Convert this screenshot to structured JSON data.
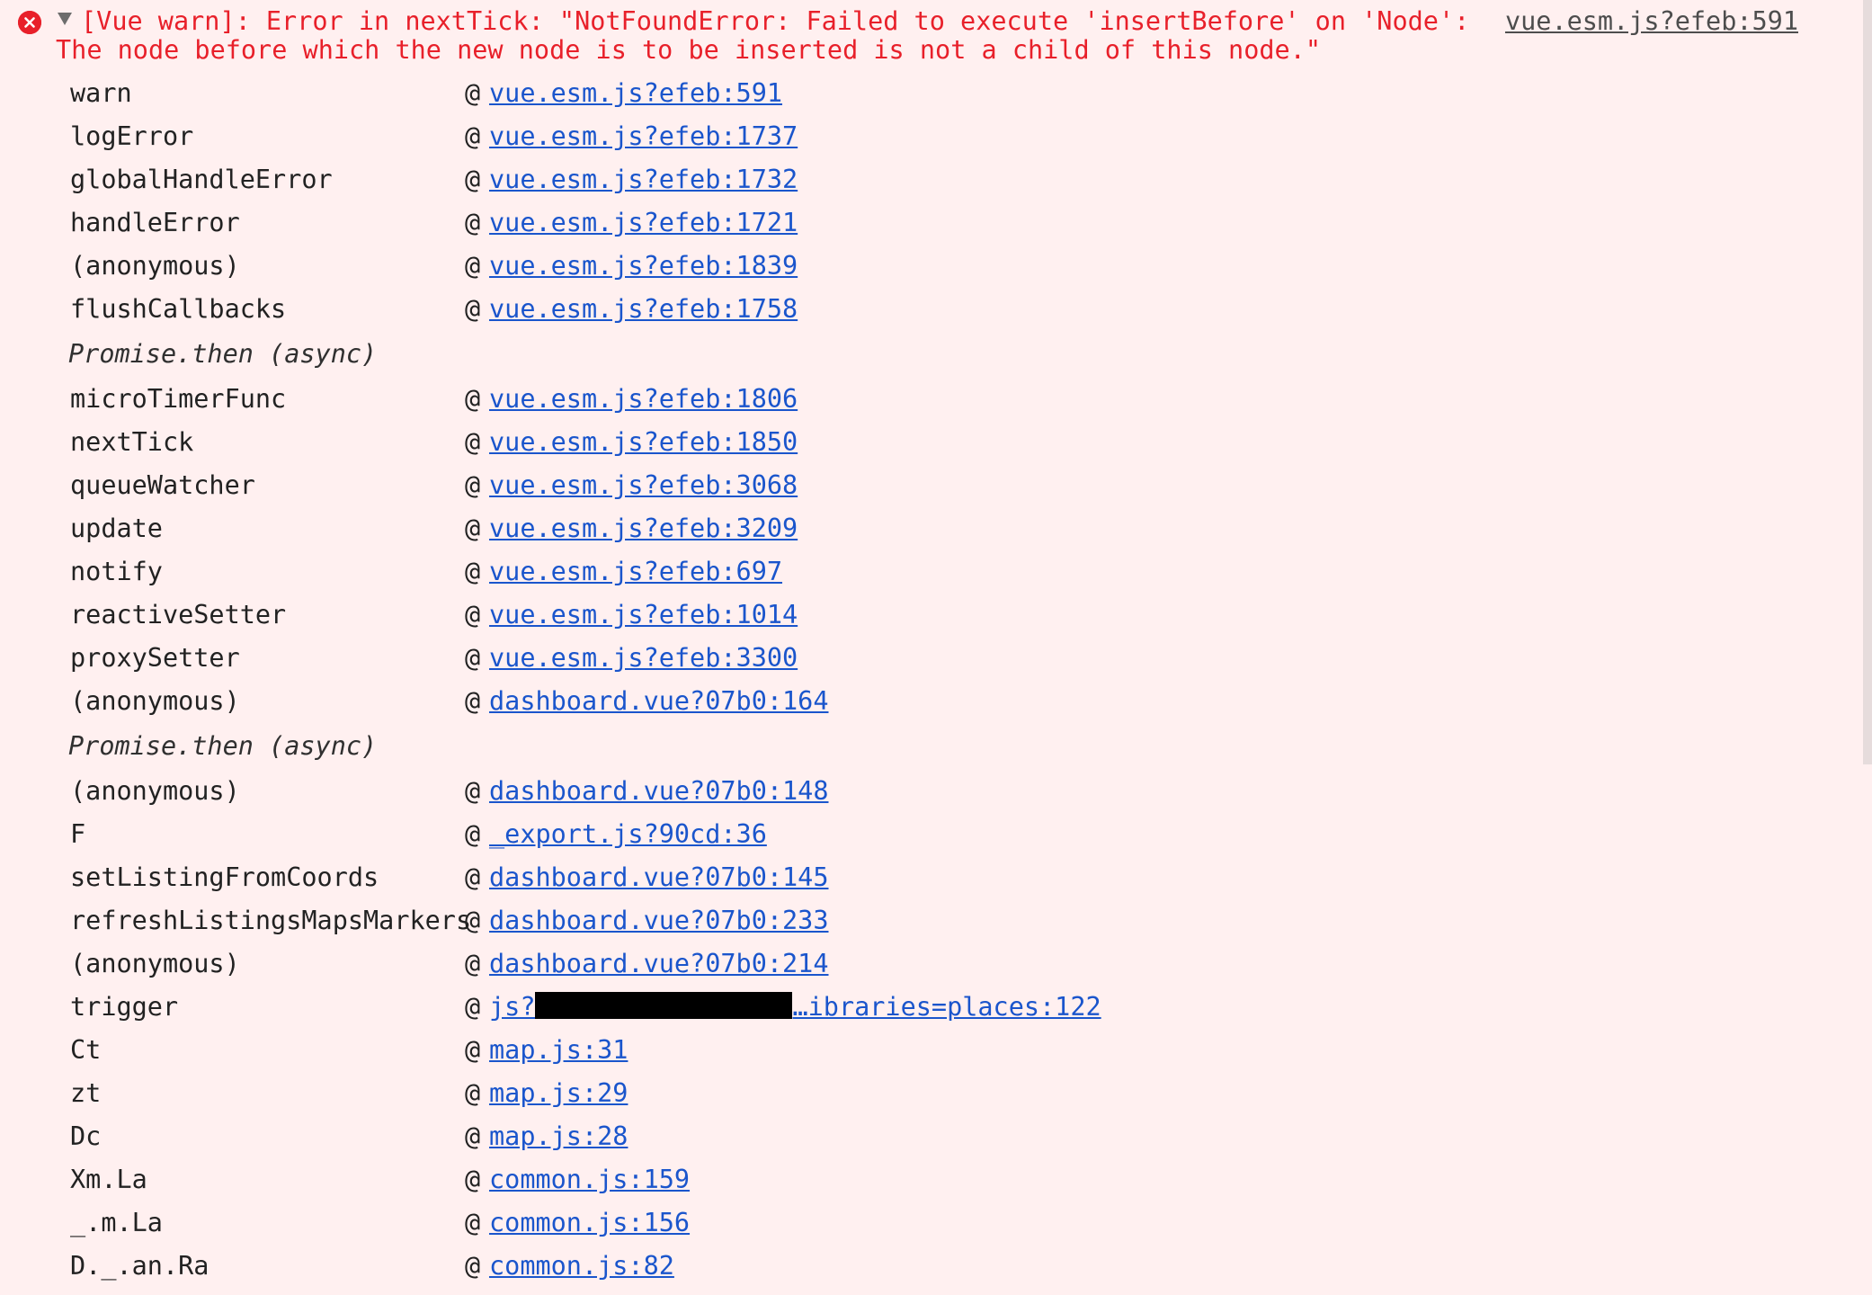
{
  "theme": {
    "background": "#fff0f0",
    "error_color": "#e8202a",
    "link_color": "#1a55cc",
    "text_color": "#222222"
  },
  "message": {
    "icon": "error-icon",
    "toggle_icon": "triangle-down-icon",
    "text": "[Vue warn]: Error in nextTick: \"NotFoundError: Failed to execute 'insertBefore' on 'Node': The node before which the new node is to be inserted is not a child of this node.\"",
    "source": "vue.esm.js?efeb:591"
  },
  "stack": [
    {
      "fn": "warn",
      "at": "@",
      "loc": "vue.esm.js?efeb:591"
    },
    {
      "fn": "logError",
      "at": "@",
      "loc": "vue.esm.js?efeb:1737"
    },
    {
      "fn": "globalHandleError",
      "at": "@",
      "loc": "vue.esm.js?efeb:1732"
    },
    {
      "fn": "handleError",
      "at": "@",
      "loc": "vue.esm.js?efeb:1721"
    },
    {
      "fn": "(anonymous)",
      "at": "@",
      "loc": "vue.esm.js?efeb:1839"
    },
    {
      "fn": "flushCallbacks",
      "at": "@",
      "loc": "vue.esm.js?efeb:1758"
    },
    {
      "async": "Promise.then (async)"
    },
    {
      "fn": "microTimerFunc",
      "at": "@",
      "loc": "vue.esm.js?efeb:1806"
    },
    {
      "fn": "nextTick",
      "at": "@",
      "loc": "vue.esm.js?efeb:1850"
    },
    {
      "fn": "queueWatcher",
      "at": "@",
      "loc": "vue.esm.js?efeb:3068"
    },
    {
      "fn": "update",
      "at": "@",
      "loc": "vue.esm.js?efeb:3209"
    },
    {
      "fn": "notify",
      "at": "@",
      "loc": "vue.esm.js?efeb:697"
    },
    {
      "fn": "reactiveSetter",
      "at": "@",
      "loc": "vue.esm.js?efeb:1014"
    },
    {
      "fn": "proxySetter",
      "at": "@",
      "loc": "vue.esm.js?efeb:3300"
    },
    {
      "fn": "(anonymous)",
      "at": "@",
      "loc": "dashboard.vue?07b0:164"
    },
    {
      "async": "Promise.then (async)"
    },
    {
      "fn": "(anonymous)",
      "at": "@",
      "loc": "dashboard.vue?07b0:148"
    },
    {
      "fn": "F",
      "at": "@",
      "loc": "_export.js?90cd:36"
    },
    {
      "fn": "setListingFromCoords",
      "at": "@",
      "loc": "dashboard.vue?07b0:145"
    },
    {
      "fn": "refreshListingsMapsMarkers",
      "at": "@",
      "loc": "dashboard.vue?07b0:233"
    },
    {
      "fn": "(anonymous)",
      "at": "@",
      "loc": "dashboard.vue?07b0:214"
    },
    {
      "fn": "trigger",
      "at": "@",
      "loc_prefix": "js?",
      "redacted": true,
      "loc_suffix": "…ibraries=places:122"
    },
    {
      "fn": "Ct",
      "at": "@",
      "loc": "map.js:31"
    },
    {
      "fn": "zt",
      "at": "@",
      "loc": "map.js:29"
    },
    {
      "fn": "Dc",
      "at": "@",
      "loc": "map.js:28"
    },
    {
      "fn": "Xm.La",
      "at": "@",
      "loc": "common.js:159"
    },
    {
      "fn": "_.m.La",
      "at": "@",
      "loc": "common.js:156"
    },
    {
      "fn": "D._.an.Ra",
      "at": "@",
      "loc": "common.js:82"
    }
  ]
}
